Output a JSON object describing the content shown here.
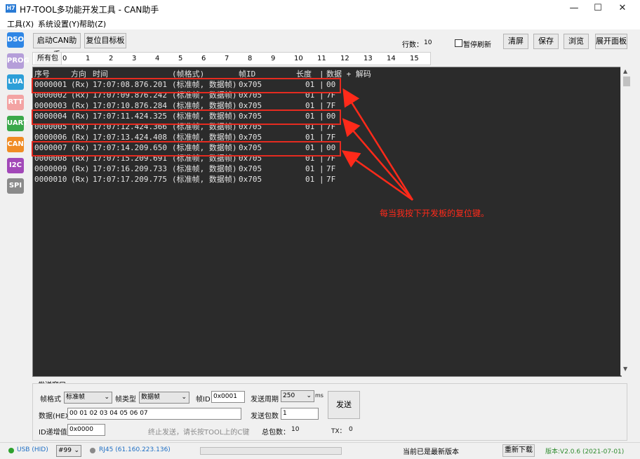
{
  "window": {
    "icon_text": "H7",
    "title": "H7-TOOL多功能开发工具 - CAN助手",
    "minimize": "—",
    "maximize": "☐",
    "close": "✕"
  },
  "menu": [
    "工具(X)",
    "系统设置(Y)",
    "帮助(Z)"
  ],
  "sidebar": [
    {
      "label": "DSO",
      "color": "#2f86e5"
    },
    {
      "label": "PROG",
      "color": "#b59ed9"
    },
    {
      "label": "LUA",
      "color": "#2d9fd8"
    },
    {
      "label": "RTT",
      "color": "#f3a3a3"
    },
    {
      "label": "UART",
      "color": "#3aa84a"
    },
    {
      "label": "CAN",
      "color": "#f08c24"
    },
    {
      "label": "I2C",
      "color": "#a248b8"
    },
    {
      "label": "SPI",
      "color": "#8a8a8a"
    }
  ],
  "toolbar": {
    "start_can": "启动CAN助手",
    "reset_target": "复位目标板",
    "rows_label": "行数：",
    "rows_value": "10",
    "pause_refresh": "暂停刷新",
    "clear": "清屏",
    "save": "保存",
    "browse": "浏览",
    "expand_panel": "展开面板"
  },
  "tabs": [
    "所有包",
    "0",
    "1",
    "2",
    "3",
    "4",
    "5",
    "6",
    "7",
    "8",
    "9",
    "10",
    "11",
    "12",
    "13",
    "14",
    "15"
  ],
  "console": {
    "header": {
      "seq": "序号",
      "dir": "方向",
      "time": "时间",
      "format": "(帧格式)",
      "id": "帧ID",
      "len": "长度",
      "sep": "|",
      "data": "数据 + 解码"
    },
    "rows": [
      {
        "seq": "0000001",
        "dir": "(Rx)",
        "time": "17:07:08.876.201",
        "format": "(标准帧, 数据帧)",
        "id": "0x705",
        "len": "01",
        "sep": "|",
        "data": "00"
      },
      {
        "seq": "0000002",
        "dir": "(Rx)",
        "time": "17:07:09.876.242",
        "format": "(标准帧, 数据帧)",
        "id": "0x705",
        "len": "01",
        "sep": "|",
        "data": "7F"
      },
      {
        "seq": "0000003",
        "dir": "(Rx)",
        "time": "17:07:10.876.284",
        "format": "(标准帧, 数据帧)",
        "id": "0x705",
        "len": "01",
        "sep": "|",
        "data": "7F"
      },
      {
        "seq": "0000004",
        "dir": "(Rx)",
        "time": "17:07:11.424.325",
        "format": "(标准帧, 数据帧)",
        "id": "0x705",
        "len": "01",
        "sep": "|",
        "data": "00"
      },
      {
        "seq": "0000005",
        "dir": "(Rx)",
        "time": "17:07:12.424.366",
        "format": "(标准帧, 数据帧)",
        "id": "0x705",
        "len": "01",
        "sep": "|",
        "data": "7F"
      },
      {
        "seq": "0000006",
        "dir": "(Rx)",
        "time": "17:07:13.424.408",
        "format": "(标准帧, 数据帧)",
        "id": "0x705",
        "len": "01",
        "sep": "|",
        "data": "7F"
      },
      {
        "seq": "0000007",
        "dir": "(Rx)",
        "time": "17:07:14.209.650",
        "format": "(标准帧, 数据帧)",
        "id": "0x705",
        "len": "01",
        "sep": "|",
        "data": "00"
      },
      {
        "seq": "0000008",
        "dir": "(Rx)",
        "time": "17:07:15.209.691",
        "format": "(标准帧, 数据帧)",
        "id": "0x705",
        "len": "01",
        "sep": "|",
        "data": "7F"
      },
      {
        "seq": "0000009",
        "dir": "(Rx)",
        "time": "17:07:16.209.733",
        "format": "(标准帧, 数据帧)",
        "id": "0x705",
        "len": "01",
        "sep": "|",
        "data": "7F"
      },
      {
        "seq": "0000010",
        "dir": "(Rx)",
        "time": "17:07:17.209.775",
        "format": "(标准帧, 数据帧)",
        "id": "0x705",
        "len": "01",
        "sep": "|",
        "data": "7F"
      }
    ]
  },
  "annotation": {
    "text": "每当我按下开发板的复位键。",
    "color": "#ff2a1a"
  },
  "send": {
    "title": "发送窗口",
    "frame_format_label": "帧格式",
    "frame_format_value": "标准帧",
    "frame_type_label": "帧类型",
    "frame_type_value": "数据帧",
    "frame_id_label": "帧ID",
    "frame_id_value": "0x0001",
    "period_label": "发送周期",
    "period_value": "250",
    "period_unit": "ms",
    "data_label": "数据(HEX)",
    "data_value": "00 01 02 03 04 05 06 07",
    "packets_label": "发送包数",
    "packets_value": "1",
    "send_button": "发送",
    "id_inc_label": "ID递增值",
    "id_inc_value": "0x0000",
    "hint": "终止发送，请长按TOOL上的C键",
    "total_label": "总包数：",
    "total_value": "10",
    "tx_label": "TX：",
    "tx_value": "0"
  },
  "status": {
    "usb": "USB (HID)",
    "port": "#99",
    "rj45": "RJ45 (61.160.223.136)",
    "latest": "当前已是最新版本",
    "reload": "重新下载",
    "version": "版本:V2.0.6 (2021-07-01)"
  }
}
